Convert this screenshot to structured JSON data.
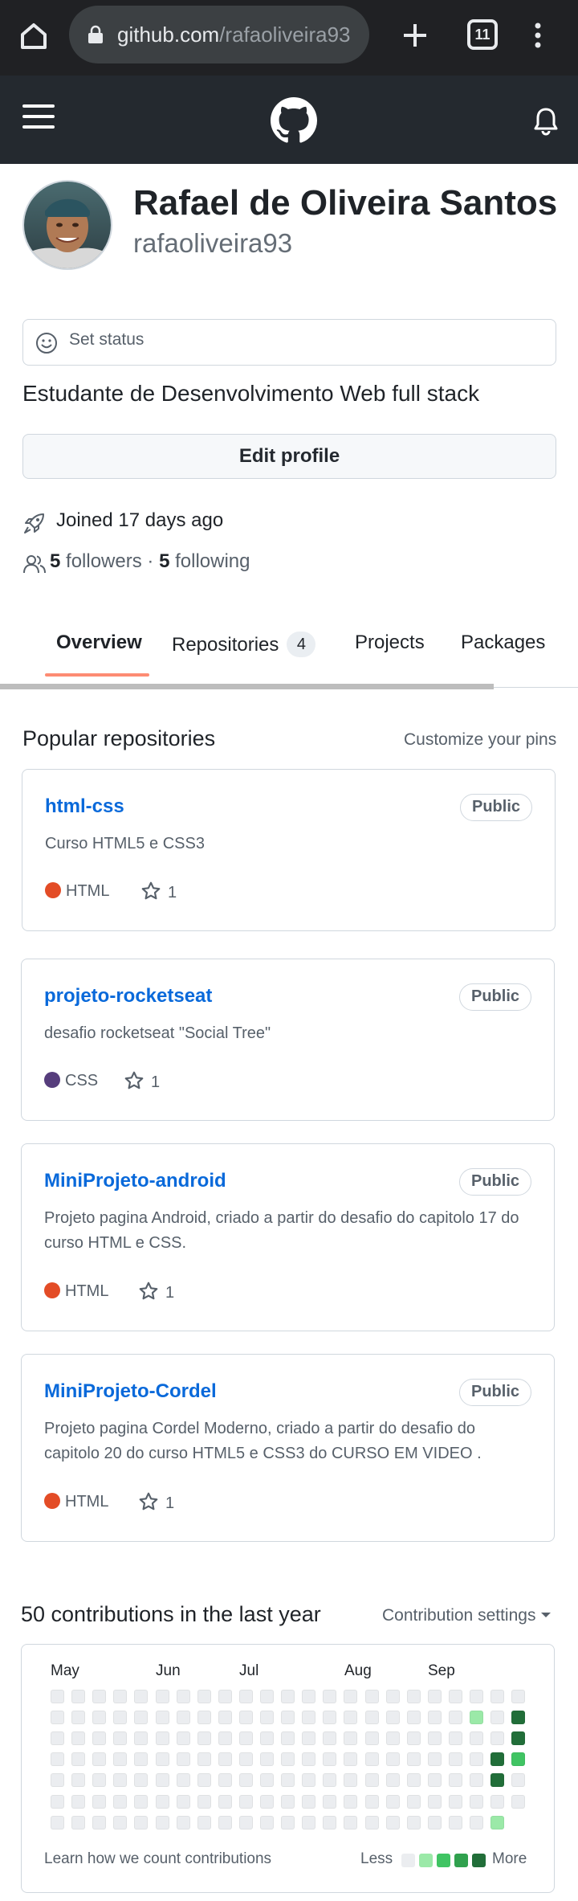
{
  "browser": {
    "url_domain": "github.com",
    "url_path": "/rafaoliveira93",
    "tab_count": "11"
  },
  "profile": {
    "full_name": "Rafael de Oliveira Santos",
    "username": "rafaoliveira93",
    "status_label": "Set status",
    "bio": "Estudante de Desenvolvimento Web full stack",
    "edit_label": "Edit profile",
    "joined": "Joined 17 days ago",
    "followers_count": "5",
    "followers_label": "followers",
    "separator": "·",
    "following_count": "5",
    "following_label": "following"
  },
  "tabs": [
    {
      "label": "Overview",
      "active": true
    },
    {
      "label": "Repositories",
      "count": "4"
    },
    {
      "label": "Projects"
    },
    {
      "label": "Packages"
    }
  ],
  "popular": {
    "title": "Popular repositories",
    "customize": "Customize your pins",
    "repos": [
      {
        "name": "html-css",
        "visibility": "Public",
        "description": "Curso HTML5 e CSS3",
        "language": "HTML",
        "language_color": "#e34c26",
        "stars": "1"
      },
      {
        "name": "projeto-rocketseat",
        "visibility": "Public",
        "description": "desafio rocketseat \"Social Tree\"",
        "language": "CSS",
        "language_color": "#563d7c",
        "stars": "1"
      },
      {
        "name": "MiniProjeto-android",
        "visibility": "Public",
        "description": "Projeto pagina Android, criado a partir do desafio do capitolo 17 do curso HTML e CSS.",
        "language": "HTML",
        "language_color": "#e34c26",
        "stars": "1"
      },
      {
        "name": "MiniProjeto-Cordel",
        "visibility": "Public",
        "description": "Projeto pagina Cordel Moderno, criado a partir do desafio do capitolo 20 do curso HTML5 e CSS3 do CURSO EM VIDEO .",
        "language": "HTML",
        "language_color": "#e34c26",
        "stars": "1"
      }
    ]
  },
  "contributions": {
    "title": "50 contributions in the last year",
    "settings": "Contribution settings",
    "months": [
      "May",
      "Jun",
      "Jul",
      "Aug",
      "Sep"
    ],
    "learn": "Learn how we count contributions",
    "less": "Less",
    "more": "More",
    "level_colors": [
      "#ebedf0",
      "#9be9a8",
      "#40c463",
      "#30a14e",
      "#216e39"
    ],
    "weeks": 23,
    "last_week_days": 6,
    "active_cells": [
      {
        "week": 20,
        "day": 1,
        "level": 1
      },
      {
        "week": 22,
        "day": 1,
        "level": 4
      },
      {
        "week": 22,
        "day": 2,
        "level": 4
      },
      {
        "week": 21,
        "day": 3,
        "level": 4
      },
      {
        "week": 22,
        "day": 3,
        "level": 2
      },
      {
        "week": 21,
        "day": 4,
        "level": 4
      },
      {
        "week": 21,
        "day": 6,
        "level": 1
      }
    ]
  }
}
